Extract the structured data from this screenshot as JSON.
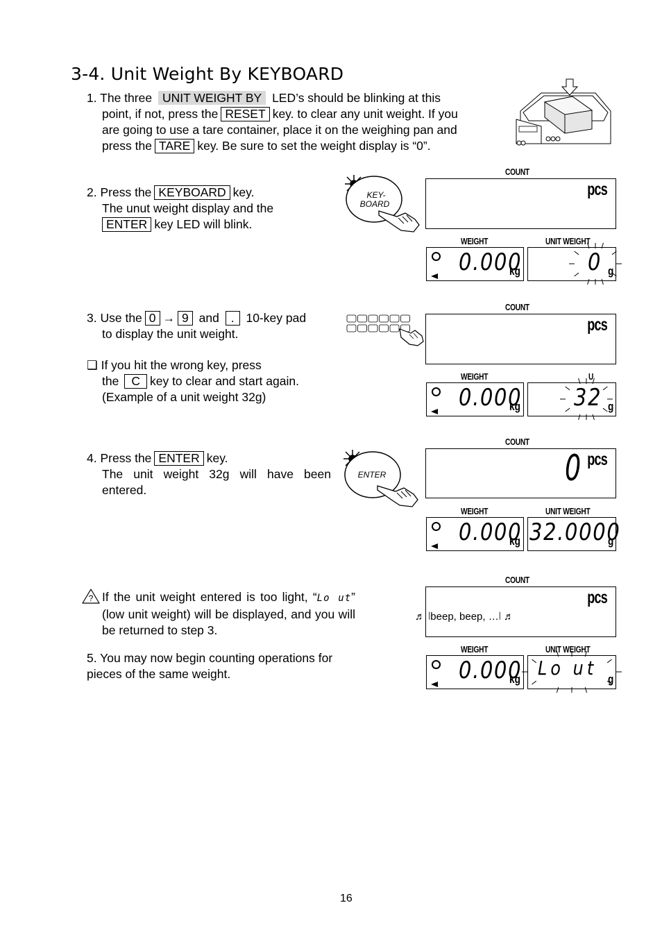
{
  "title": "3-4. Unit Weight By KEYBOARD",
  "step1": {
    "num": "1.",
    "t1": "The three",
    "led": "UNIT WEIGHT BY",
    "t2": "LED’s should be blinking at this",
    "t3": "point, if not, press the",
    "key_reset": "RESET",
    "t4": "key. to clear any unit weight. If you",
    "t5": "are going to use a tare container, place it on the weighing pan and",
    "t6": "press the",
    "key_tare": "TARE",
    "t7": "key. Be sure to set the weight display is “0”."
  },
  "step2": {
    "num": "2.",
    "t1": "Press the",
    "key_keyboard": "KEYBOARD",
    "t2": "key.",
    "t3": "The unut weight display and the",
    "key_enter": "ENTER",
    "t4": "key LED will blink."
  },
  "step3": {
    "num": "3.",
    "t1": "Use the",
    "key_0": "0",
    "arrow": "→",
    "key_9": "9",
    "t2": "and",
    "key_dot": ".",
    "t3": "10-key pad",
    "t4": "to display the unit weight.",
    "bullet": "❑",
    "t5": "If you hit the wrong key, press",
    "t6": "the",
    "key_c": "C",
    "t7": "key to clear and start again.",
    "t8": "(Example of a unit weight 32g)"
  },
  "step4": {
    "num": "4.",
    "t1": "Press the",
    "key_enter": "ENTER",
    "t2": "key.",
    "t3": "The unit weight 32g will have been entered."
  },
  "warning": {
    "t1": "If the unit weight entered is too light, “",
    "lcd_text": "Lo ut",
    "t2": "”",
    "t3": "(low unit weight) will be displayed, and you will be returned to step 3."
  },
  "step5": {
    "num": "5.",
    "t1": "You may now begin counting operations for pieces of the same weight."
  },
  "key_icons": {
    "keyboard": [
      "KEY-",
      "BOARD"
    ],
    "enter": "ENTER"
  },
  "displays": [
    {
      "count_label": "COUNT",
      "pcs": "pcs",
      "count_value": "",
      "weight_label": "WEIGHT",
      "weight_value": "0.000",
      "weight_unit": "kg",
      "unit_weight_label": "UNIT  WEIGHT",
      "unit_weight_value": "0",
      "unit_weight_unit": "g",
      "blinking": true
    },
    {
      "count_label": "COUNT",
      "pcs": "pcs",
      "count_value": "",
      "weight_label": "WEIGHT",
      "weight_value": "0.000",
      "weight_unit": "kg",
      "unit_weight_label": "U",
      "unit_weight_value": "32",
      "unit_weight_unit": "g",
      "blinking": true
    },
    {
      "count_label": "COUNT",
      "pcs": "pcs",
      "count_value": "0",
      "weight_label": "WEIGHT",
      "weight_value": "0.000",
      "weight_unit": "kg",
      "unit_weight_label": "UNIT  WEIGHT",
      "unit_weight_value": "32.0000",
      "unit_weight_unit": "g",
      "blinking": false
    },
    {
      "count_label": "COUNT",
      "pcs": "pcs",
      "count_value": "",
      "beep": "♬ ⦚beep, beep, …⦚ ♬",
      "weight_label": "WEIGHT",
      "weight_value": "0.000",
      "weight_unit": "kg",
      "unit_weight_label": "UNIT  WEIGHT",
      "unit_weight_value": "Lo  ut",
      "unit_weight_unit": "g",
      "blinking": true
    }
  ],
  "page_number": "16"
}
